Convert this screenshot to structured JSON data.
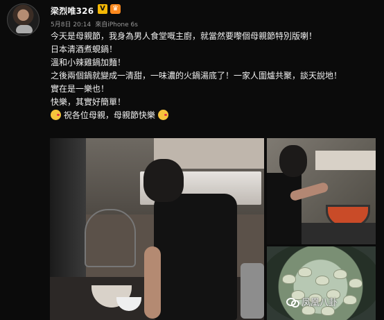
{
  "user": {
    "name": "梁烈唯326",
    "verified_badge": "V",
    "crown_badge": "♛"
  },
  "post": {
    "date": "5月8日 20:14",
    "source": "來自iPhone 6s",
    "lines": [
      "今天是母親節，我身為男人食堂嘅主廚，就當然要嚟個母親節特別版喇！",
      "日本清酒煮蜆鍋！",
      "溫和小辣雞鍋加麵！",
      "之後兩個鍋就變成一清甜，一味濃的火鍋湯底了！一家人圍爐共聚，談天說地！",
      "實在是一樂也！",
      "快樂，其實好簡單！",
      "祝各位母親，母親節快樂"
    ],
    "emoji_name": "kiss-face-icon"
  },
  "watermark": {
    "text": "凤凰八卦",
    "icon": "fenghuang-logo-icon"
  }
}
